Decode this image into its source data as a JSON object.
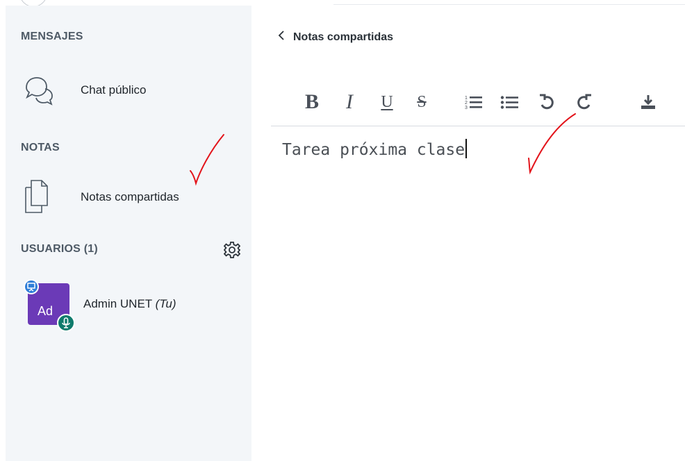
{
  "sidebar": {
    "sections": {
      "messages": "MENSAJES",
      "notes": "NOTAS",
      "users": "USUARIOS (1)"
    },
    "chat_item": {
      "label": "Chat público",
      "icon": "chat-bubbles-icon"
    },
    "notes_item": {
      "label": "Notas compartidas",
      "icon": "document-icon"
    },
    "users_settings_icon": "gear-icon",
    "users": [
      {
        "avatar_initials": "Ad",
        "avatar_color": "#6b3ab7",
        "name": "Admin UNET",
        "self_tag": "(Tu)",
        "presenter_badge_color": "#2f7ed8",
        "mic_badge_color": "#0f7b6c"
      }
    ]
  },
  "panel": {
    "back_icon": "chevron-left-icon",
    "title": "Notas compartidas",
    "toolbar": {
      "bold": "B",
      "italic": "I",
      "underline": "U",
      "strikethrough": "S",
      "buttons": [
        "bold",
        "italic",
        "underline",
        "strikethrough",
        "ordered-list",
        "unordered-list",
        "undo",
        "redo",
        "download"
      ]
    },
    "editor_text": "Tarea próxima clase"
  },
  "colors": {
    "sidebar_bg": "#f3f6f9",
    "annotation_red": "#e3141b"
  }
}
